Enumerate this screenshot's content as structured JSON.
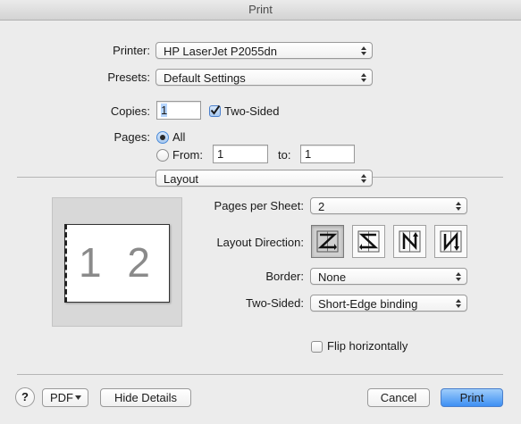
{
  "window": {
    "title": "Print"
  },
  "printer": {
    "label": "Printer:",
    "value": "HP LaserJet P2055dn"
  },
  "presets": {
    "label": "Presets:",
    "value": "Default Settings"
  },
  "copies": {
    "label": "Copies:",
    "value": "1",
    "two_sided_label": "Two-Sided",
    "two_sided_checked": true
  },
  "pages": {
    "label": "Pages:",
    "all_label": "All",
    "from_label": "From:",
    "from_value": "1",
    "to_label": "to:",
    "to_value": "1",
    "selected": "All"
  },
  "section": {
    "value": "Layout"
  },
  "preview": {
    "page_numbers": "1 2"
  },
  "layout": {
    "pages_per_sheet_label": "Pages per Sheet:",
    "pages_per_sheet_value": "2",
    "direction_label": "Layout Direction:",
    "directions": [
      "z-pattern-icon",
      "reverse-z-pattern-icon",
      "n-down-icon",
      "reverse-n-down-icon"
    ],
    "border_label": "Border:",
    "border_value": "None",
    "two_sided_label": "Two-Sided:",
    "two_sided_value": "Short-Edge binding",
    "flip_label": "Flip horizontally",
    "flip_checked": false
  },
  "footer": {
    "help": "?",
    "pdf": "PDF",
    "hide_details": "Hide Details",
    "cancel": "Cancel",
    "print": "Print"
  },
  "colors": {
    "accent": "#3d8ff3",
    "window_bg": "#ececec"
  }
}
